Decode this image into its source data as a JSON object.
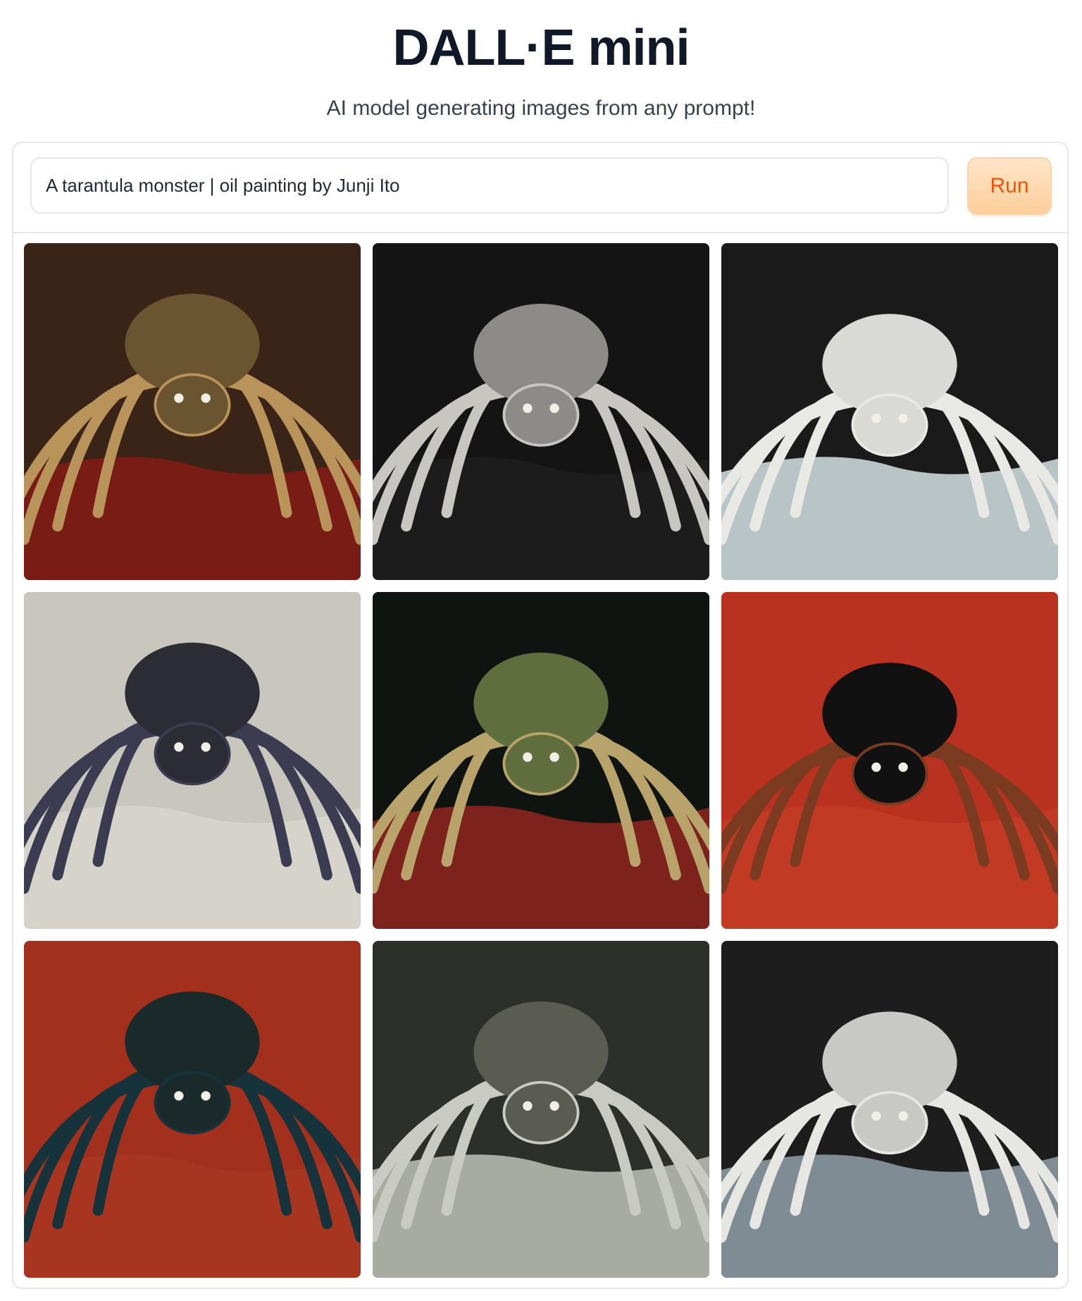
{
  "header": {
    "title": "DALL·E mini",
    "subtitle": "AI model generating images from any prompt!"
  },
  "prompt": {
    "value": "A tarantula monster | oil painting by Junji Ito"
  },
  "run_button": {
    "label": "Run"
  },
  "gallery": {
    "images": [
      {
        "bg": "#3a2418",
        "floor": "#7a1c16",
        "body": "#6b5430",
        "legs": "#b8935a"
      },
      {
        "bg": "#141414",
        "floor": "#1c1c1c",
        "body": "#8d8b87",
        "legs": "#c8c6c0"
      },
      {
        "bg": "#1a1a1a",
        "floor": "#b9c4c6",
        "body": "#d9d9d6",
        "legs": "#e8e8e5"
      },
      {
        "bg": "#c9c6bd",
        "floor": "#d6d3cb",
        "body": "#2c2c35",
        "legs": "#3b3b52"
      },
      {
        "bg": "#0f1410",
        "floor": "#7d221c",
        "body": "#5f6e3c",
        "legs": "#b8a46a"
      },
      {
        "bg": "#b9321f",
        "floor": "#c23a24",
        "body": "#111111",
        "legs": "#7a3b20"
      },
      {
        "bg": "#a3301c",
        "floor": "#a83520",
        "body": "#1a2a2a",
        "legs": "#16323a"
      },
      {
        "bg": "#2d2f2a",
        "floor": "#a8aca0",
        "body": "#5b5c51",
        "legs": "#c9cbc3"
      },
      {
        "bg": "#1d1d1d",
        "floor": "#7f8c94",
        "body": "#c8c8c4",
        "legs": "#e6e6e2"
      }
    ]
  }
}
